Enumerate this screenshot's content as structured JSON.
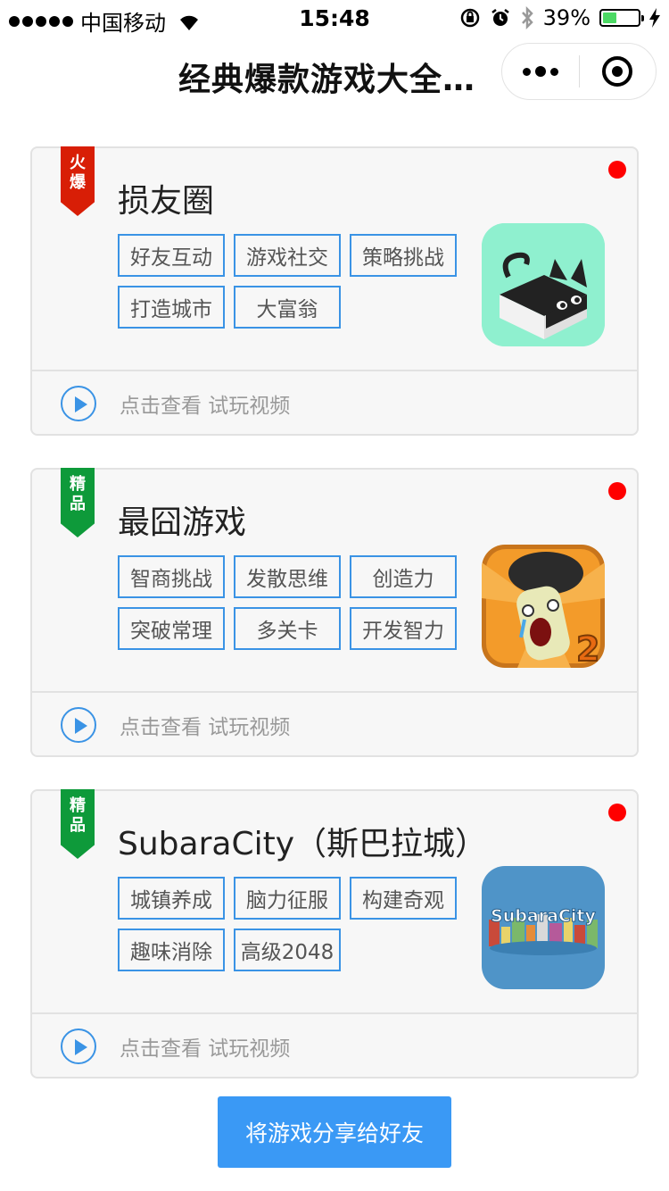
{
  "status_bar": {
    "carrier": "中国移动",
    "time": "15:48",
    "battery": "39%",
    "battery_level": 0.39
  },
  "nav": {
    "title": "经典爆款游戏大全…"
  },
  "cards": [
    {
      "badge": [
        "火",
        "爆"
      ],
      "badge_color": "#d81e06",
      "title": "损友圈",
      "tags": [
        "好友互动",
        "游戏社交",
        "策略挑战",
        "打造城市",
        "大富翁"
      ],
      "video_text": "点击查看 试玩视频",
      "icon": "husky-cube-icon"
    },
    {
      "badge": [
        "精",
        "品"
      ],
      "badge_color": "#0e9a3a",
      "title": "最囧游戏",
      "tags": [
        "智商挑战",
        "发散思维",
        "创造力",
        "突破常理",
        "多关卡",
        "开发智力"
      ],
      "video_text": "点击查看 试玩视频",
      "icon": "mushroom-crying-icon"
    },
    {
      "badge": [
        "精",
        "品"
      ],
      "badge_color": "#0e9a3a",
      "title": "SubaraCity（斯巴拉城）",
      "tags": [
        "城镇养成",
        "脑力征服",
        "构建奇观",
        "趣味消除",
        "高级2048"
      ],
      "video_text": "点击查看 试玩视频",
      "icon": "subaracity-logo-icon",
      "icon_text": "SubaraCity"
    }
  ],
  "share_button": "将游戏分享给好友"
}
